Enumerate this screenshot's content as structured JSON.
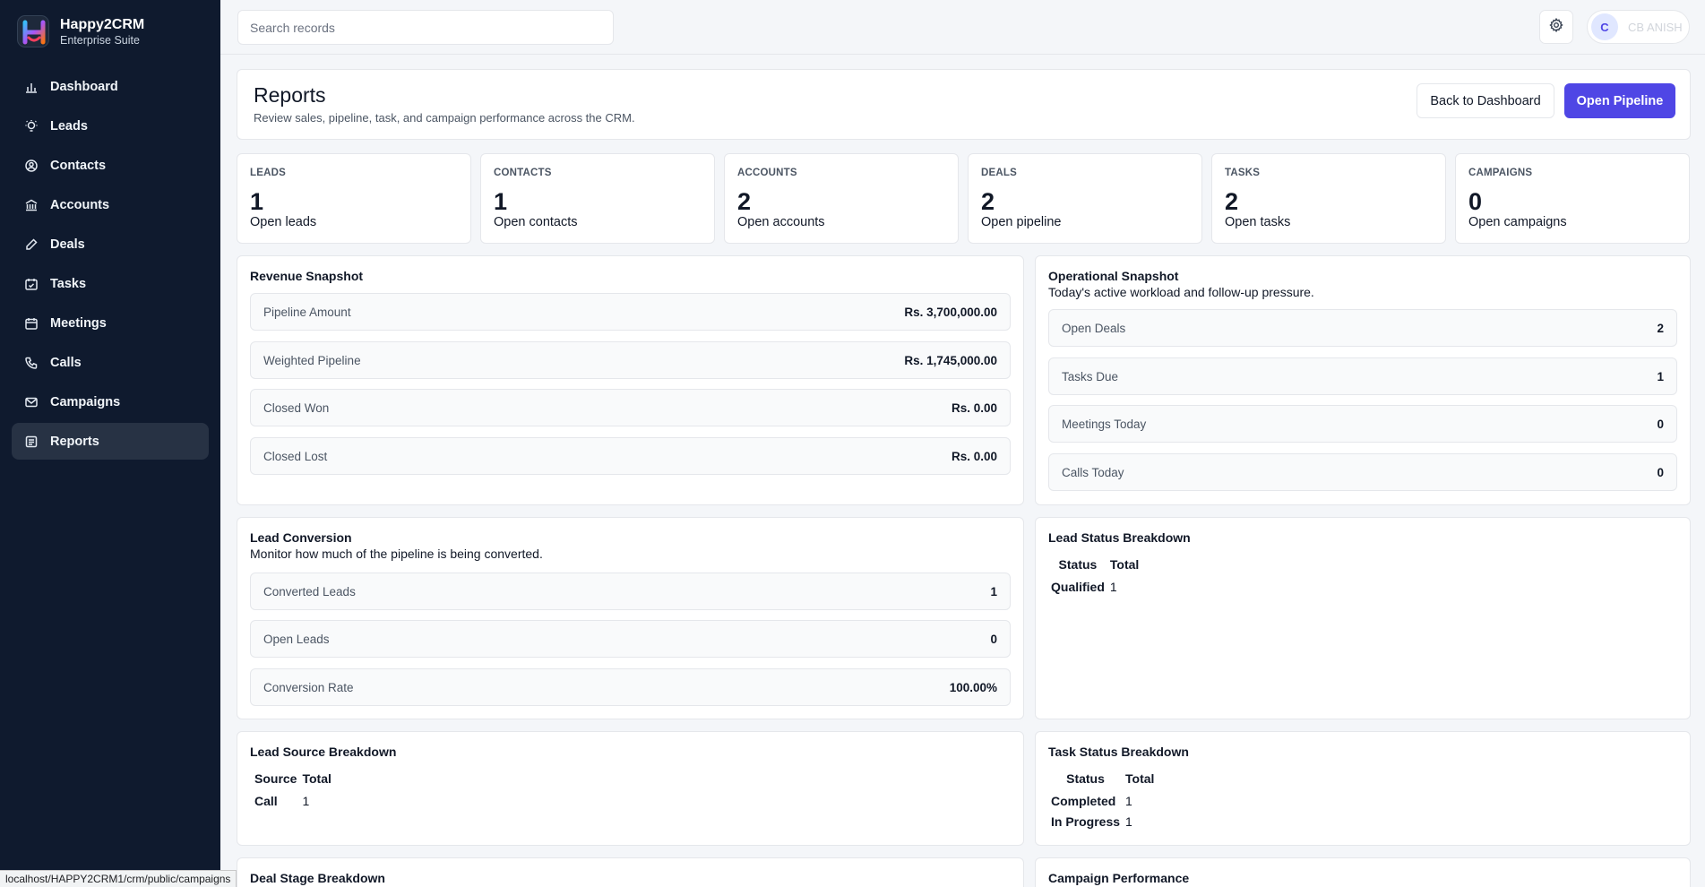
{
  "app": {
    "name": "Happy2CRM",
    "subtitle": "Enterprise Suite"
  },
  "sidebar": {
    "items": [
      {
        "label": "Dashboard",
        "icon": "chart-bar-icon"
      },
      {
        "label": "Leads",
        "icon": "lightbulb-icon"
      },
      {
        "label": "Contacts",
        "icon": "user-circle-icon"
      },
      {
        "label": "Accounts",
        "icon": "bank-icon"
      },
      {
        "label": "Deals",
        "icon": "pencil-icon"
      },
      {
        "label": "Tasks",
        "icon": "calendar-check-icon"
      },
      {
        "label": "Meetings",
        "icon": "calendar-icon"
      },
      {
        "label": "Calls",
        "icon": "phone-icon"
      },
      {
        "label": "Campaigns",
        "icon": "mail-icon"
      },
      {
        "label": "Reports",
        "icon": "report-icon",
        "active": true
      }
    ]
  },
  "topbar": {
    "search_placeholder": "Search records",
    "user_initial": "C",
    "user_name": "CB ANISH"
  },
  "header": {
    "title": "Reports",
    "subtitle": "Review sales, pipeline, task, and campaign performance across the CRM.",
    "back_label": "Back to Dashboard",
    "pipeline_label": "Open Pipeline"
  },
  "kpis": [
    {
      "label": "LEADS",
      "value": "1",
      "desc": "Open leads"
    },
    {
      "label": "CONTACTS",
      "value": "1",
      "desc": "Open contacts"
    },
    {
      "label": "ACCOUNTS",
      "value": "2",
      "desc": "Open accounts"
    },
    {
      "label": "DEALS",
      "value": "2",
      "desc": "Open pipeline"
    },
    {
      "label": "TASKS",
      "value": "2",
      "desc": "Open tasks"
    },
    {
      "label": "CAMPAIGNS",
      "value": "0",
      "desc": "Open campaigns"
    }
  ],
  "revenue": {
    "title": "Revenue Snapshot",
    "rows": [
      {
        "label": "Pipeline Amount",
        "value": "Rs. 3,700,000.00"
      },
      {
        "label": "Weighted Pipeline",
        "value": "Rs. 1,745,000.00"
      },
      {
        "label": "Closed Won",
        "value": "Rs. 0.00"
      },
      {
        "label": "Closed Lost",
        "value": "Rs. 0.00"
      }
    ]
  },
  "operational": {
    "title": "Operational Snapshot",
    "subtitle": "Today's active workload and follow-up pressure.",
    "rows": [
      {
        "label": "Open Deals",
        "value": "2"
      },
      {
        "label": "Tasks Due",
        "value": "1"
      },
      {
        "label": "Meetings Today",
        "value": "0"
      },
      {
        "label": "Calls Today",
        "value": "0"
      }
    ]
  },
  "conversion": {
    "title": "Lead Conversion",
    "subtitle": "Monitor how much of the pipeline is being converted.",
    "rows": [
      {
        "label": "Converted Leads",
        "value": "1"
      },
      {
        "label": "Open Leads",
        "value": "0"
      },
      {
        "label": "Conversion Rate",
        "value": "100.00%"
      }
    ]
  },
  "lead_status": {
    "title": "Lead Status Breakdown",
    "headers": [
      "Status",
      "Total"
    ],
    "rows": [
      {
        "label": "Qualified",
        "value": "1"
      }
    ]
  },
  "lead_source": {
    "title": "Lead Source Breakdown",
    "headers": [
      "Source",
      "Total"
    ],
    "rows": [
      {
        "label": "Call",
        "value": "1"
      }
    ]
  },
  "task_status": {
    "title": "Task Status Breakdown",
    "headers": [
      "Status",
      "Total"
    ],
    "rows": [
      {
        "label": "Completed",
        "value": "1"
      },
      {
        "label": "In Progress",
        "value": "1"
      }
    ]
  },
  "deal_stage": {
    "title": "Deal Stage Breakdown"
  },
  "campaign_perf": {
    "title": "Campaign Performance"
  },
  "statusbar": {
    "url": "localhost/HAPPY2CRM1/crm/public/campaigns"
  },
  "colors": {
    "sidebar_bg": "#0f1a2e",
    "accent": "#4f46e5",
    "page_bg": "#f4f6f9"
  }
}
